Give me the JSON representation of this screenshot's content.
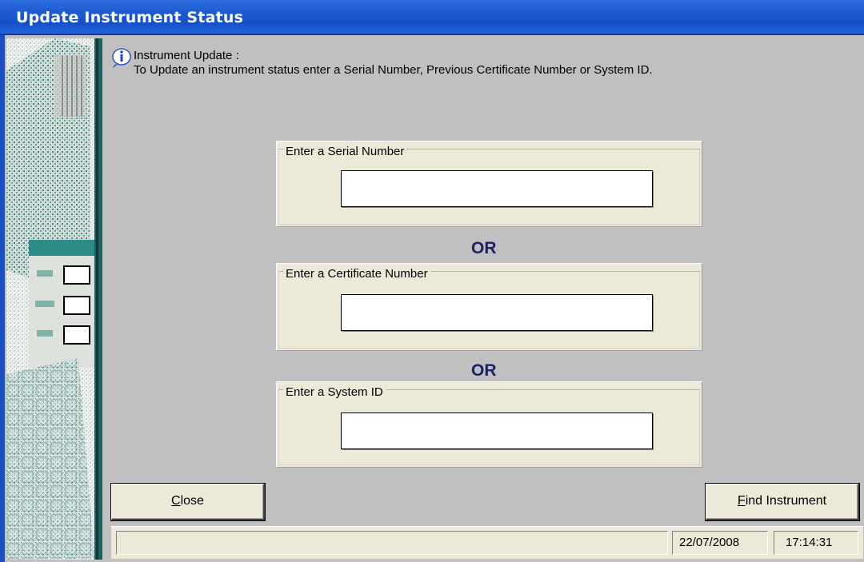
{
  "window": {
    "title": "Update Instrument Status"
  },
  "info": {
    "icon": "info-icon",
    "title": "Instrument Update :",
    "description": "To Update an instrument status enter a Serial Number, Previous Certificate Number or System ID."
  },
  "groups": [
    {
      "label": "Enter a Serial Number",
      "value": ""
    },
    {
      "label": "Enter a Certificate Number",
      "value": ""
    },
    {
      "label": "Enter a System ID",
      "value": ""
    }
  ],
  "separator": "OR",
  "buttons": {
    "close": {
      "accel": "C",
      "rest": "lose"
    },
    "find": {
      "accel": "F",
      "rest": "ind Instrument"
    }
  },
  "status": {
    "message": "",
    "date": "22/07/2008",
    "time": "17:14:31"
  },
  "colors": {
    "title_bar": "#1d59d0",
    "dialog_bg": "#c0c0c0",
    "panel_bg": "#ece9d8",
    "or_text": "#1c2266"
  }
}
